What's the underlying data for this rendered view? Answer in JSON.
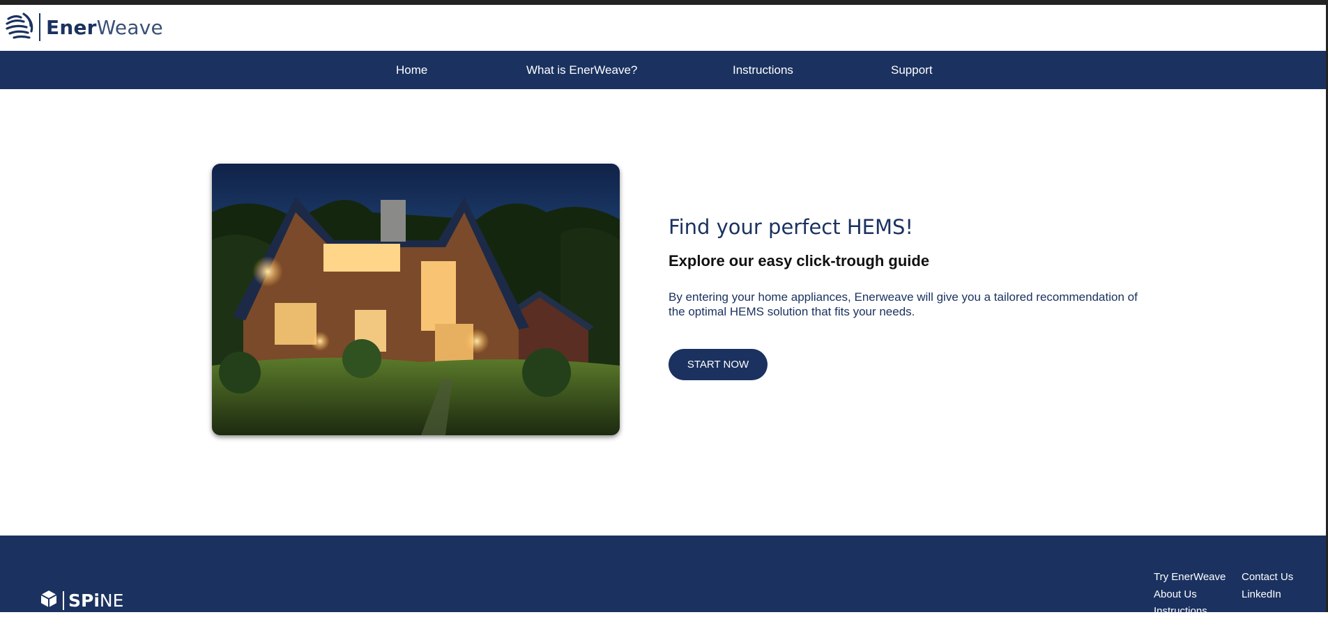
{
  "brand": {
    "name_bold": "Ener",
    "name_light": "Weave",
    "icon": "enerweave-logo-icon"
  },
  "nav": {
    "items": [
      {
        "label": "Home"
      },
      {
        "label": "What is EnerWeave?"
      },
      {
        "label": "Instructions"
      },
      {
        "label": "Support"
      }
    ]
  },
  "hero": {
    "image": "house-at-dusk-photo",
    "title": "Find your perfect HEMS!",
    "subtitle": "Explore our easy click-trough guide",
    "description": "By entering your home appliances, Enerweave will give you a tailored recommendation of the optimal HEMS solution that fits your needs.",
    "cta_label": "START NOW"
  },
  "footer": {
    "logo_bold": "SPi",
    "logo_light": "NE",
    "logo_icon": "spine-cube-icon",
    "links": [
      {
        "label": "Try EnerWeave"
      },
      {
        "label": "Contact Us"
      },
      {
        "label": "About Us"
      },
      {
        "label": "LinkedIn"
      },
      {
        "label": "Instructions"
      }
    ]
  },
  "colors": {
    "primary": "#1b3260",
    "background": "#ffffff",
    "text_dark": "#111111"
  }
}
